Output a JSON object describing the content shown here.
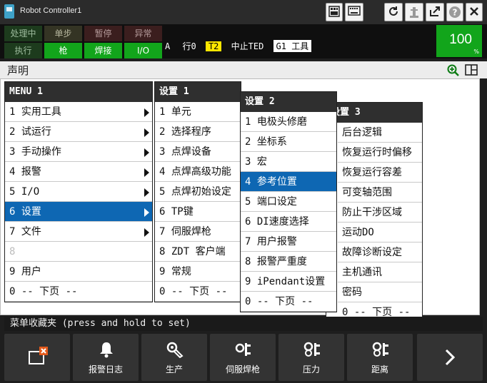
{
  "app": {
    "title": "Robot Controller1"
  },
  "leds": {
    "busy": "处理中",
    "step": "单步",
    "hold": "暂停",
    "fault": "异常",
    "run": "执行",
    "gun": "枪",
    "weld": "焊接",
    "io": "I/O"
  },
  "status_line": {
    "mode": "A",
    "line": "行0",
    "tool_tag": "T2",
    "state": "中止TED",
    "frame_label": "G1 工具"
  },
  "override": {
    "value": "100",
    "unit": "%"
  },
  "page": {
    "title": "声明"
  },
  "menu1": {
    "title": "MENU  1",
    "items": [
      {
        "label": "1 实用工具",
        "arrow": true
      },
      {
        "label": "2 试运行",
        "arrow": true
      },
      {
        "label": "3 手动操作",
        "arrow": true
      },
      {
        "label": "4 报警",
        "arrow": true
      },
      {
        "label": "5 I/O",
        "arrow": true
      },
      {
        "label": "6 设置",
        "arrow": true,
        "selected": true
      },
      {
        "label": "7 文件",
        "arrow": true
      },
      {
        "label": "8",
        "dim": true
      },
      {
        "label": "9 用户"
      },
      {
        "label": "0 -- 下页 --"
      }
    ]
  },
  "menu2": {
    "title": "设置  1",
    "items": [
      {
        "label": "1 单元"
      },
      {
        "label": "2 选择程序"
      },
      {
        "label": "3 点焊设备"
      },
      {
        "label": "4 点焊高级功能"
      },
      {
        "label": "5 点焊初始设定"
      },
      {
        "label": "6 TP键"
      },
      {
        "label": "7 伺服焊枪"
      },
      {
        "label": "8 ZDT 客户端"
      },
      {
        "label": "9 常规"
      },
      {
        "label": "0 -- 下页 --"
      }
    ]
  },
  "menu3": {
    "title": "设置  2",
    "items": [
      {
        "label": "1 电极头修磨"
      },
      {
        "label": "2 坐标系"
      },
      {
        "label": "3 宏"
      },
      {
        "label": "4 参考位置",
        "selected": true
      },
      {
        "label": "5 端口设定"
      },
      {
        "label": "6 DI速度选择"
      },
      {
        "label": "7 用户报警"
      },
      {
        "label": "8 报警严重度"
      },
      {
        "label": "9 iPendant设置"
      },
      {
        "label": "0 -- 下页 --"
      }
    ]
  },
  "menu4": {
    "title": "设置  3",
    "items": [
      {
        "label": "后台逻辑"
      },
      {
        "label": "恢复运行时偏移"
      },
      {
        "label": "恢复运行容差"
      },
      {
        "label": "可变轴范围"
      },
      {
        "label": "防止干涉区域"
      },
      {
        "label": "运动DO"
      },
      {
        "label": "故障诊断设定"
      },
      {
        "label": "主机通讯"
      },
      {
        "label": "密码"
      },
      {
        "label": "0 -- 下页 --"
      }
    ]
  },
  "favorites": {
    "label": "菜单收藏夹 (press and hold to set)"
  },
  "toolbar": {
    "alarm_log": "报警日志",
    "production": "生产",
    "servo_gun": "伺服焊枪",
    "pressure": "压力",
    "distance": "距离"
  },
  "colors": {
    "selection": "#0e67b3",
    "led_on": "#12a51b",
    "tag_yellow": "#ffe600"
  }
}
